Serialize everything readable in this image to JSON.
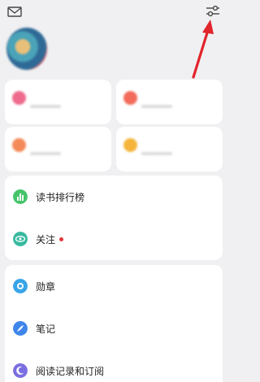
{
  "topbar": {
    "mail_icon": "mail-icon",
    "settings_icon": "settings-sliders-icon"
  },
  "profile": {
    "name": "",
    "subtitle": ""
  },
  "assets": [
    {
      "icon_color": "#ee6b8e"
    },
    {
      "icon_color": "#f26b5b"
    },
    {
      "icon_color": "#f48a5a"
    },
    {
      "icon_color": "#f5b53c"
    }
  ],
  "list1": [
    {
      "label": "读书排行榜",
      "icon": "chart-bars-icon",
      "icon_color": "#45c46a",
      "value": ""
    },
    {
      "label": "关注",
      "icon": "eye-icon",
      "icon_color": "#38b9a0",
      "value": "",
      "badge_color": "#e2343a"
    }
  ],
  "list2": [
    {
      "label": "勋章",
      "icon": "medal-icon",
      "icon_color": "#37a5e8"
    },
    {
      "label": "笔记",
      "icon": "feather-icon",
      "icon_color": "#3f86ea"
    },
    {
      "label": "阅读记录和订阅",
      "icon": "moon-icon",
      "icon_color": "#7a6fe0"
    }
  ],
  "annotation": {
    "arrow_color": "#e3242b"
  }
}
